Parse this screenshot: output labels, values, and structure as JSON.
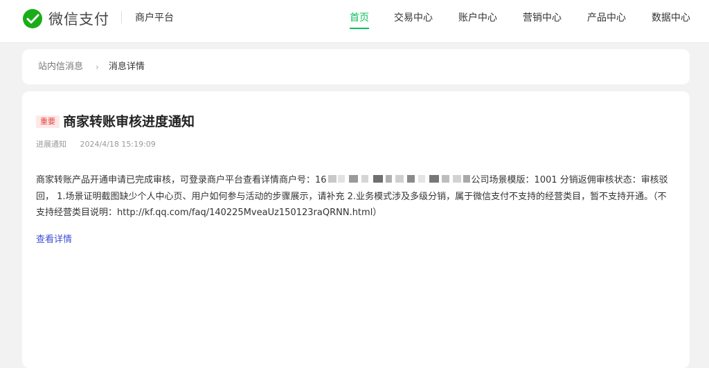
{
  "header": {
    "brand_name": "微信支付",
    "platform_label": "商户平台",
    "nav": [
      {
        "label": "首页",
        "active": true
      },
      {
        "label": "交易中心",
        "active": false
      },
      {
        "label": "账户中心",
        "active": false
      },
      {
        "label": "营销中心",
        "active": false
      },
      {
        "label": "产品中心",
        "active": false
      },
      {
        "label": "数据中心",
        "active": false
      }
    ]
  },
  "breadcrumb": {
    "parent": "站内信消息",
    "current": "消息详情"
  },
  "message": {
    "badge": "重要",
    "title": "商家转账审核进度通知",
    "category": "进展通知",
    "datetime": "2024/4/18 15:19:09",
    "body_before_redaction": "商家转账产品开通申请已完成审核，可登录商户平台查看详情商户号：16",
    "body_after_redaction": "公司场景模版：1001 分销返佣审核状态：审核驳回， 1.场景证明截图缺少个人中心页、用户如何参与活动的步骤展示，请补充 2.业务模式涉及多级分销，属于微信支付不支持的经营类目，暂不支持开通。（不支持经营类目说明：http://kf.qq.com/faq/140225MveaUz150123raQRNN.html）",
    "detail_link": "查看详情"
  },
  "colors": {
    "accent_green": "#07c160",
    "badge_red": "#e3483f",
    "link_blue": "#3e4fd6"
  },
  "icons": {
    "brand": "wechat-pay-logo-icon",
    "breadcrumb_separator": "chevron-right-icon"
  }
}
